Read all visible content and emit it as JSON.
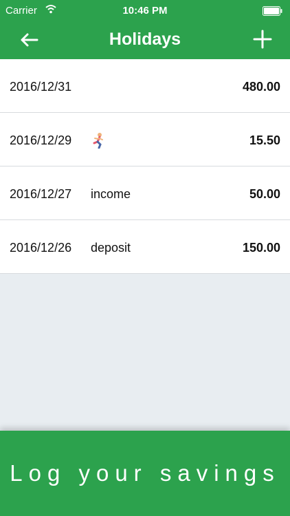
{
  "statusbar": {
    "carrier": "Carrier",
    "time": "10:46 PM"
  },
  "navbar": {
    "title": "Holidays"
  },
  "entries": [
    {
      "date": "2016/12/31",
      "note": "",
      "amount": "480.00"
    },
    {
      "date": "2016/12/29",
      "note_icon": "runner-icon",
      "amount": "15.50"
    },
    {
      "date": "2016/12/27",
      "note": "income",
      "amount": "50.00"
    },
    {
      "date": "2016/12/26",
      "note": "deposit",
      "amount": "150.00"
    }
  ],
  "cta": {
    "label": "Log your savings"
  },
  "colors": {
    "brand_green": "#2ca24d",
    "background": "#e8edf1"
  }
}
